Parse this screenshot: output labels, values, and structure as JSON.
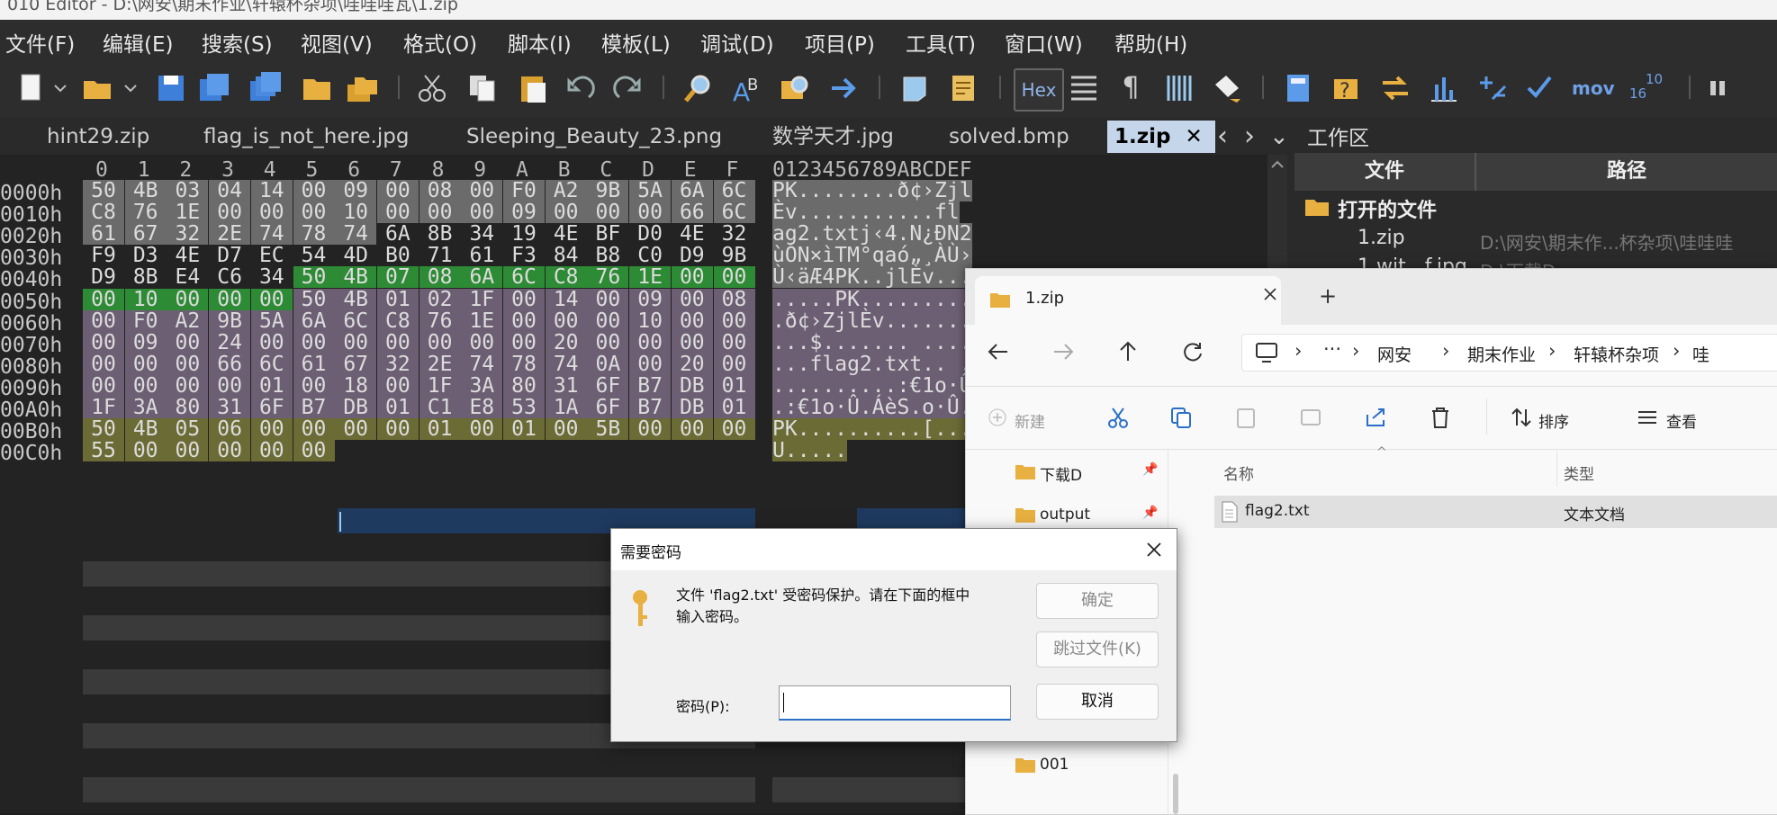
{
  "window_title": "010 Editor - D:\\网安\\期末作业\\轩辕杯杂项\\哇哇哇瓦\\1.zip",
  "menu": [
    "文件(F)",
    "编辑(E)",
    "搜索(S)",
    "视图(V)",
    "格式(O)",
    "脚本(I)",
    "模板(L)",
    "调试(D)",
    "项目(P)",
    "工具(T)",
    "窗口(W)",
    "帮助(H)"
  ],
  "toolbar": {
    "hex_label": "Hex",
    "pilcrow": "¶",
    "mov_label": "mov",
    "conv_top": "10",
    "conv_bottom": "16"
  },
  "tabs": [
    {
      "label": "hint29.zip",
      "active": false
    },
    {
      "label": "flag_is_not_here.jpg",
      "active": false
    },
    {
      "label": "Sleeping_Beauty_23.png",
      "active": false
    },
    {
      "label": "数学天才.jpg",
      "active": false
    },
    {
      "label": "solved.bmp",
      "active": false
    },
    {
      "label": "1.zip",
      "active": true
    }
  ],
  "tab_close": "✕",
  "tab_nav": {
    "prev": "‹",
    "next": "›",
    "menu": "⌄"
  },
  "hex": {
    "col_headers": [
      "0",
      "1",
      "2",
      "3",
      "4",
      "5",
      "6",
      "7",
      "8",
      "9",
      "A",
      "B",
      "C",
      "D",
      "E",
      "F"
    ],
    "ascii_header": "0123456789ABCDEF",
    "rows": [
      {
        "addr": "0000h",
        "bytes": [
          "50",
          "4B",
          "03",
          "04",
          "14",
          "00",
          "09",
          "00",
          "08",
          "00",
          "F0",
          "A2",
          "9B",
          "5A",
          "6A",
          "6C"
        ],
        "ascii": "PK........ð¢›Zjl"
      },
      {
        "addr": "0010h",
        "bytes": [
          "C8",
          "76",
          "1E",
          "00",
          "00",
          "00",
          "10",
          "00",
          "00",
          "00",
          "09",
          "00",
          "00",
          "00",
          "66",
          "6C"
        ],
        "ascii": "Èv...........fl"
      },
      {
        "addr": "0020h",
        "bytes": [
          "61",
          "67",
          "32",
          "2E",
          "74",
          "78",
          "74",
          "6A",
          "8B",
          "34",
          "19",
          "4E",
          "BF",
          "D0",
          "4E",
          "32"
        ],
        "ascii": "ag2.txtj‹4.N¿ÐN2"
      },
      {
        "addr": "0030h",
        "bytes": [
          "F9",
          "D3",
          "4E",
          "D7",
          "EC",
          "54",
          "4D",
          "B0",
          "71",
          "61",
          "F3",
          "84",
          "B8",
          "C0",
          "D9",
          "9B"
        ],
        "ascii": "ùÓN×ìTM°qaó„¸ÀÙ›"
      },
      {
        "addr": "0040h",
        "bytes": [
          "D9",
          "8B",
          "E4",
          "C6",
          "34",
          "50",
          "4B",
          "07",
          "08",
          "6A",
          "6C",
          "C8",
          "76",
          "1E",
          "00",
          "00"
        ],
        "ascii": "Ù‹äÆ4PK..jlÈv..."
      },
      {
        "addr": "0050h",
        "bytes": [
          "00",
          "10",
          "00",
          "00",
          "00",
          "50",
          "4B",
          "01",
          "02",
          "1F",
          "00",
          "14",
          "00",
          "09",
          "00",
          "08"
        ],
        "ascii": ".....PK........."
      },
      {
        "addr": "0060h",
        "bytes": [
          "00",
          "F0",
          "A2",
          "9B",
          "5A",
          "6A",
          "6C",
          "C8",
          "76",
          "1E",
          "00",
          "00",
          "00",
          "10",
          "00",
          "00"
        ],
        "ascii": ".ð¢›ZjlÈv......."
      },
      {
        "addr": "0070h",
        "bytes": [
          "00",
          "09",
          "00",
          "24",
          "00",
          "00",
          "00",
          "00",
          "00",
          "00",
          "00",
          "20",
          "00",
          "00",
          "00",
          "00"
        ],
        "ascii": "...$....... ...."
      },
      {
        "addr": "0080h",
        "bytes": [
          "00",
          "00",
          "00",
          "66",
          "6C",
          "61",
          "67",
          "32",
          "2E",
          "74",
          "78",
          "74",
          "0A",
          "00",
          "20",
          "00"
        ],
        "ascii": "...flag2.txt.. ."
      },
      {
        "addr": "0090h",
        "bytes": [
          "00",
          "00",
          "00",
          "00",
          "01",
          "00",
          "18",
          "00",
          "1F",
          "3A",
          "80",
          "31",
          "6F",
          "B7",
          "DB",
          "01"
        ],
        "ascii": "..........:€1o·Û."
      },
      {
        "addr": "00A0h",
        "bytes": [
          "1F",
          "3A",
          "80",
          "31",
          "6F",
          "B7",
          "DB",
          "01",
          "C1",
          "E8",
          "53",
          "1A",
          "6F",
          "B7",
          "DB",
          "01"
        ],
        "ascii": ".:€1o·Û.ÁèS.o·Û."
      },
      {
        "addr": "00B0h",
        "bytes": [
          "50",
          "4B",
          "05",
          "06",
          "00",
          "00",
          "00",
          "00",
          "01",
          "00",
          "01",
          "00",
          "5B",
          "00",
          "00",
          "00"
        ],
        "ascii": "PK..........[..."
      },
      {
        "addr": "00C0h",
        "bytes": [
          "55",
          "00",
          "00",
          "00",
          "00",
          "00"
        ],
        "ascii": "U....."
      }
    ]
  },
  "workspace": {
    "title": "工作区",
    "col_file": "文件",
    "col_path": "路径",
    "group": "打开的文件",
    "items": [
      {
        "name": "1.zip",
        "path": "D:\\网安\\期末作...杯杂项\\哇哇哇"
      },
      {
        "name": "1.wit...f.jpg",
        "path": "D:\\下载D"
      }
    ]
  },
  "explorer": {
    "tab_title": "1.zip",
    "new_tab": "+",
    "breadcrumb": [
      "网安",
      "期末作业",
      "轩辕杯杂项",
      "哇"
    ],
    "toolbar": {
      "new": "新建",
      "sort": "排序",
      "view": "查看"
    },
    "sidebar": [
      "下载D",
      "output",
      "001"
    ],
    "columns": {
      "name": "名称",
      "type": "类型"
    },
    "files": [
      {
        "name": "flag2.txt",
        "type": "文本文档"
      }
    ]
  },
  "dialog": {
    "title": "需要密码",
    "message_line1": "文件 'flag2.txt' 受密码保护。请在下面的框中",
    "message_line2": "输入密码。",
    "ok": "确定",
    "skip": "跳过文件(K)",
    "cancel": "取消",
    "password_label": "密码(P):",
    "password_value": ""
  },
  "colors": {
    "hex_bg": "#232323",
    "region_gray": "#6b6b6b",
    "region_green": "#2e8b35",
    "region_purple": "#6c5f73",
    "region_olive": "#6b6b35",
    "tab_active": "#c6d6ea",
    "selection_blue": "#1f3a5f"
  }
}
